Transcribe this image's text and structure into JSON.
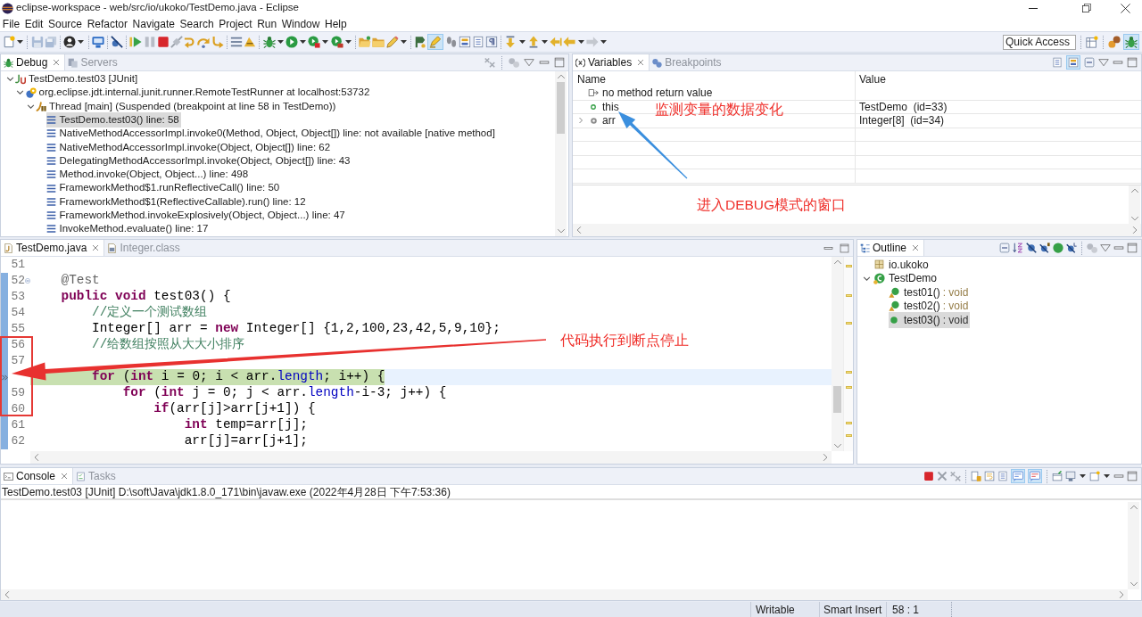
{
  "window": {
    "title": "eclipse-workspace - web/src/io/ukoko/TestDemo.java - Eclipse"
  },
  "menu": [
    "File",
    "Edit",
    "Source",
    "Refactor",
    "Navigate",
    "Search",
    "Project",
    "Run",
    "Window",
    "Help"
  ],
  "toolbar": {
    "quick_access": {
      "placeholder": "Quick Access"
    }
  },
  "debug_view": {
    "tabs": [
      {
        "label": "Debug",
        "selected": true
      },
      {
        "label": "Servers",
        "selected": false
      }
    ],
    "tree": [
      {
        "label": "TestDemo.test03 [JUnit]",
        "kind": "launch",
        "expanded": true,
        "selected": false,
        "children": [
          {
            "label": "org.eclipse.jdt.internal.junit.runner.RemoteTestRunner at localhost:53732",
            "kind": "target",
            "expanded": true,
            "selected": false,
            "children": [
              {
                "label": "Thread [main] (Suspended (breakpoint at line 58 in TestDemo))",
                "kind": "thread",
                "expanded": true,
                "selected": false,
                "children": [
                  {
                    "label": "TestDemo.test03() line: 58",
                    "kind": "frame",
                    "selected": true
                  },
                  {
                    "label": "NativeMethodAccessorImpl.invoke0(Method, Object, Object[]) line: not available [native method]",
                    "kind": "frame",
                    "selected": false
                  },
                  {
                    "label": "NativeMethodAccessorImpl.invoke(Object, Object[]) line: 62",
                    "kind": "frame",
                    "selected": false
                  },
                  {
                    "label": "DelegatingMethodAccessorImpl.invoke(Object, Object[]) line: 43",
                    "kind": "frame",
                    "selected": false
                  },
                  {
                    "label": "Method.invoke(Object, Object...) line: 498",
                    "kind": "frame",
                    "selected": false
                  },
                  {
                    "label": "FrameworkMethod$1.runReflectiveCall() line: 50",
                    "kind": "frame",
                    "selected": false
                  },
                  {
                    "label": "FrameworkMethod$1(ReflectiveCallable).run() line: 12",
                    "kind": "frame",
                    "selected": false
                  },
                  {
                    "label": "FrameworkMethod.invokeExplosively(Object, Object...) line: 47",
                    "kind": "frame",
                    "selected": false
                  },
                  {
                    "label": "InvokeMethod.evaluate() line: 17",
                    "kind": "frame",
                    "selected": false
                  }
                ]
              }
            ]
          }
        ]
      }
    ]
  },
  "variables_view": {
    "tabs": [
      {
        "label": "Variables",
        "selected": true
      },
      {
        "label": "Breakpoints",
        "selected": false
      }
    ],
    "columns": [
      "Name",
      "Value"
    ],
    "rows": [
      {
        "name": "no method return value",
        "kind": "return"
      },
      {
        "name": "this",
        "kind": "object",
        "value": "TestDemo  (id=33)"
      },
      {
        "name": "arr",
        "kind": "array",
        "expanded": false,
        "value": "Integer[8]  (id=34)"
      }
    ]
  },
  "editor": {
    "tabs": [
      {
        "label": "TestDemo.java",
        "selected": true
      },
      {
        "label": "Integer.class",
        "selected": false
      }
    ],
    "lines": [
      {
        "number": "51",
        "changed": false,
        "current": false,
        "fold": false
      },
      {
        "number": "52",
        "changed": true,
        "current": false,
        "fold": true,
        "tokens": [
          {
            "text": "    @Test",
            "kind": "annotation"
          }
        ]
      },
      {
        "number": "53",
        "changed": true,
        "current": false,
        "fold": false,
        "tokens": [
          {
            "text": "    public void",
            "kind": "keyword"
          },
          {
            "text": " test03() {",
            "kind": "plain"
          }
        ]
      },
      {
        "number": "54",
        "changed": true,
        "current": false,
        "fold": false,
        "tokens": [
          {
            "text": "        //定义一个测试数组",
            "kind": "comment"
          }
        ]
      },
      {
        "number": "55",
        "changed": true,
        "current": false,
        "fold": false,
        "tokens": [
          {
            "text": "        Integer[] arr = ",
            "kind": "plain"
          },
          {
            "text": "new",
            "kind": "keyword"
          },
          {
            "text": " Integer[] {1,2,100,23,42,5,9,10};",
            "kind": "plain"
          }
        ]
      },
      {
        "number": "56",
        "changed": true,
        "current": false,
        "fold": false,
        "tokens": [
          {
            "text": "        //给数组按照从大大小排序",
            "kind": "comment"
          }
        ]
      },
      {
        "number": "57",
        "changed": true,
        "current": false,
        "fold": false
      },
      {
        "changed": true,
        "current": true,
        "fold": false,
        "tokens": [
          {
            "text": "        for",
            "kind": "keyword"
          },
          {
            "text": " (",
            "kind": "plain"
          },
          {
            "text": "int",
            "kind": "keyword"
          },
          {
            "text": " i = 0; i < arr.",
            "kind": "plain"
          },
          {
            "text": "length",
            "kind": "field"
          },
          {
            "text": "; i++) {",
            "kind": "plain"
          }
        ]
      },
      {
        "number": "59",
        "changed": true,
        "current": false,
        "fold": false,
        "tokens": [
          {
            "text": "            for",
            "kind": "keyword"
          },
          {
            "text": " (",
            "kind": "plain"
          },
          {
            "text": "int",
            "kind": "keyword"
          },
          {
            "text": " j = 0; j < arr.",
            "kind": "plain"
          },
          {
            "text": "length",
            "kind": "field"
          },
          {
            "text": "-i-3; j++) {",
            "kind": "plain"
          }
        ]
      },
      {
        "number": "60",
        "changed": true,
        "current": false,
        "fold": false,
        "tokens": [
          {
            "text": "                if",
            "kind": "keyword"
          },
          {
            "text": "(arr[j]>arr[j+1]) {",
            "kind": "plain"
          }
        ]
      },
      {
        "number": "61",
        "changed": true,
        "current": false,
        "fold": false,
        "tokens": [
          {
            "text": "                    int",
            "kind": "keyword"
          },
          {
            "text": " temp=arr[j];",
            "kind": "plain"
          }
        ]
      },
      {
        "number": "62",
        "changed": true,
        "current": false,
        "fold": false,
        "tokens": [
          {
            "text": "                    arr[j]=arr[j+1];",
            "kind": "plain"
          }
        ]
      }
    ]
  },
  "outline": {
    "tabs": [
      {
        "label": "Outline",
        "selected": true
      }
    ],
    "tree": [
      {
        "label": "io.ukoko",
        "kind": "package",
        "selected": false
      },
      {
        "label": "TestDemo",
        "kind": "class",
        "expanded": true,
        "selected": false,
        "children": [
          {
            "label": "test01()",
            "type": ": void",
            "kind": "decorated",
            "selected": false
          },
          {
            "label": "test02()",
            "type": ": void",
            "kind": "decorated",
            "selected": false
          },
          {
            "label": "test03()",
            "type": ": void",
            "kind": "method",
            "selected": true
          }
        ]
      }
    ]
  },
  "console": {
    "tabs": [
      {
        "label": "Console",
        "selected": true
      },
      {
        "label": "Tasks",
        "selected": false
      }
    ],
    "description": "TestDemo.test03 [JUnit] D:\\soft\\Java\\jdk1.8.0_171\\bin\\javaw.exe (2022年4月28日 下午7:53:36)"
  },
  "status_bar": [
    "Writable",
    "Smart Insert",
    "58 : 1"
  ],
  "annotations": [
    {
      "text": "监测变量的数据变化"
    },
    {
      "text": "进入DEBUG模式的窗口"
    },
    {
      "text": "代码执行到断点停止"
    }
  ]
}
